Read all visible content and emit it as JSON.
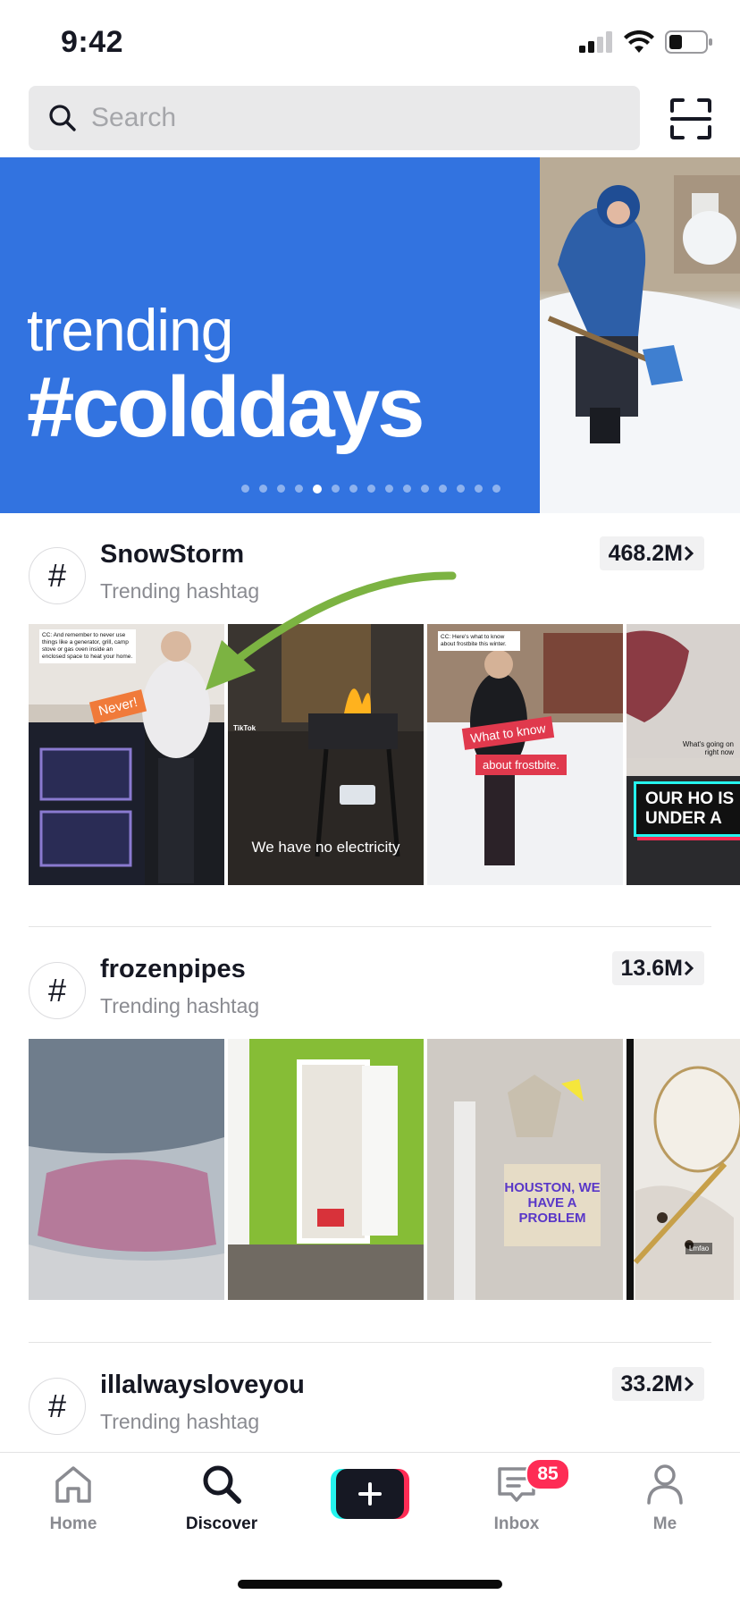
{
  "status": {
    "time": "9:42"
  },
  "search": {
    "placeholder": "Search"
  },
  "banner": {
    "line1": "trending",
    "line2": "#colddays",
    "dot_count": 15,
    "active_dot": 4
  },
  "hashtags": [
    {
      "name": "SnowStorm",
      "subtitle": "Trending hashtag",
      "count": "468.2M",
      "thumbs": [
        {
          "caption": "CC: And remember to never use things like a generator, grill, camp stove or gas oven inside an enclosed space to heat your home.",
          "sticker": "Never!"
        },
        {
          "overlay": "We have no electricity",
          "logo": "TikTok"
        },
        {
          "caption": "CC: Here's what to know about frostbite this winter.",
          "sticker": "What to know",
          "sticker2": "about frostbite."
        },
        {
          "caption": "What's going on right now",
          "sticker": "OUR HO IS UNDER A"
        }
      ]
    },
    {
      "name": "frozenpipes",
      "subtitle": "Trending hashtag",
      "count": "13.6M",
      "thumbs": [
        {},
        {},
        {
          "sign": "HOUSTON, WE HAVE A PROBLEM"
        },
        {
          "caption": "Lmfao"
        }
      ]
    },
    {
      "name": "illalwaysloveyou",
      "subtitle": "Trending hashtag",
      "count": "33.2M"
    }
  ],
  "tabs": {
    "home": "Home",
    "discover": "Discover",
    "inbox": "Inbox",
    "me": "Me",
    "inbox_badge": "85"
  },
  "colors": {
    "banner_blue": "#3273e0",
    "badge_red": "#fe2c55",
    "create_cyan": "#25f4ee",
    "arrow_green": "#7cb342"
  }
}
